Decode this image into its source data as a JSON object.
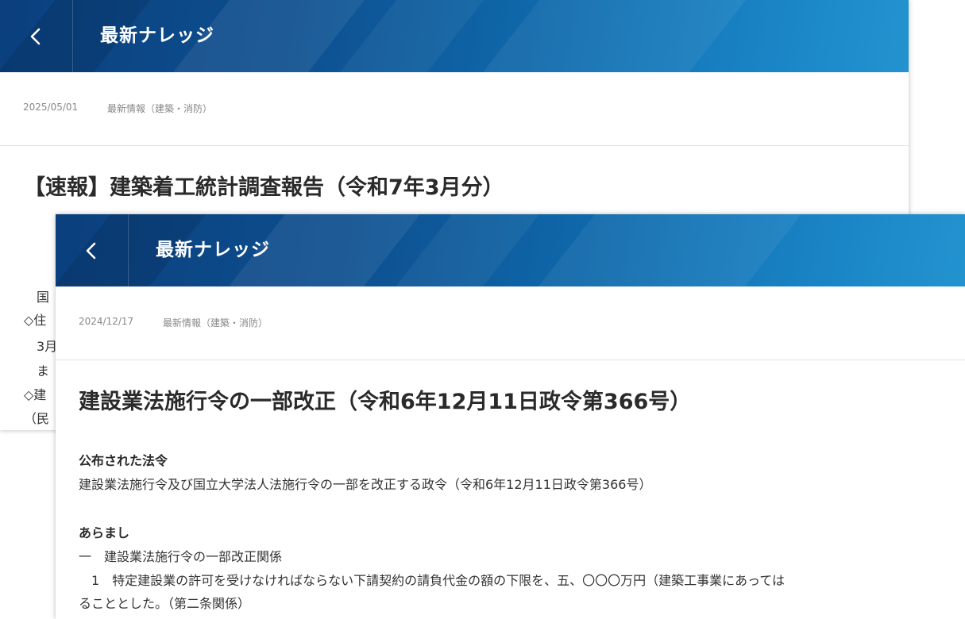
{
  "back_card": {
    "header_title": "最新ナレッジ",
    "date": "2025/05/01",
    "category": "最新情報（建築・消防）",
    "title": "【速報】建築着工統計調査報告（令和7年3月分）",
    "fragments": [
      "　国",
      "◇住",
      "　3月",
      "　ま",
      "◇建",
      "（民"
    ]
  },
  "front_card": {
    "header_title": "最新ナレッジ",
    "date": "2024/12/17",
    "category": "最新情報（建築・消防）",
    "title": "建設業法施行令の一部改正（令和6年12月11日政令第366号）",
    "sections": [
      {
        "heading": "公布された法令",
        "lines": [
          "建設業法施行令及び国立大学法人法施行令の一部を改正する政令（令和6年12月11日政令第366号）"
        ]
      },
      {
        "heading": "あらまし",
        "lines": [
          "一　建設業法施行令の一部改正関係",
          "　1　特定建設業の許可を受けなければならない下請契約の請負代金の額の下限を、五、〇〇〇万円（建築工事業にあっては",
          "ることとした。（第二条関係）"
        ]
      }
    ]
  },
  "icons": {
    "back": "chevron-left-icon"
  },
  "colors": {
    "header_dark": "#0b3f7d",
    "header_light": "#2393cf"
  }
}
